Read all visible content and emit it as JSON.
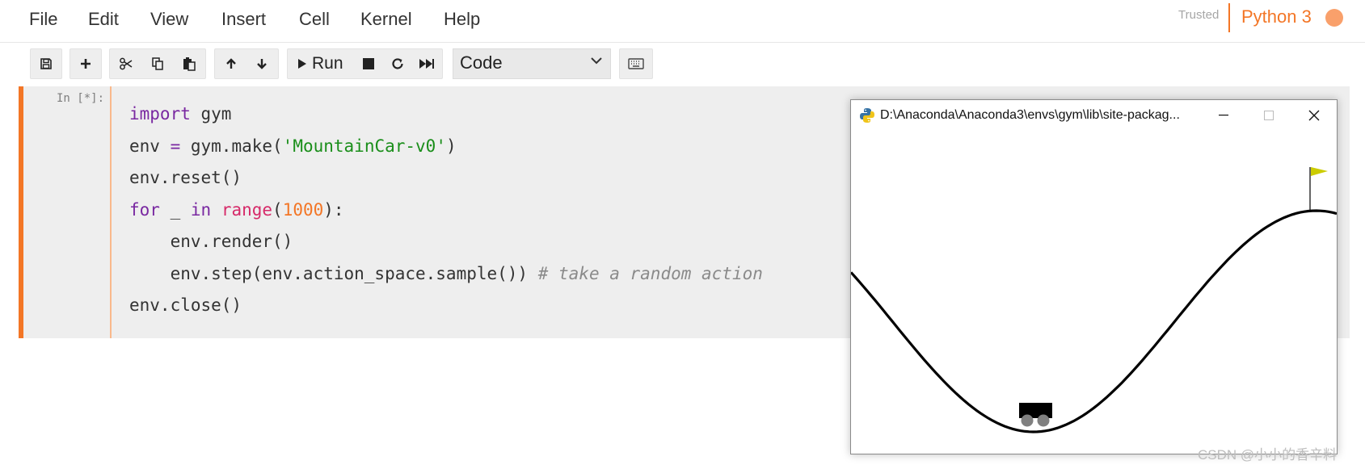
{
  "menu": {
    "items": [
      "File",
      "Edit",
      "View",
      "Insert",
      "Cell",
      "Kernel",
      "Help"
    ]
  },
  "kernel": {
    "trusted_label": "Trusted",
    "name": "Python 3",
    "status_color": "#f9a06b",
    "accent_color": "#f37626"
  },
  "toolbar": {
    "save_icon": "save-icon",
    "run_label": "Run",
    "cell_type": "Code"
  },
  "cell": {
    "prompt": "In [*]:",
    "code": {
      "line1": {
        "kw": "import",
        "rest": " gym"
      },
      "line2": {
        "a": "env ",
        "op": "=",
        "b": " gym.make(",
        "str": "'MountainCar-v0'",
        "c": ")"
      },
      "line3": "env.reset()",
      "line4": {
        "kw1": "for",
        "a": " _ ",
        "kw2": "in",
        "sp": " ",
        "bi": "range",
        "b": "(",
        "num": "1000",
        "c": "):"
      },
      "line5": "    env.render()",
      "line6": {
        "a": "    env.step(env.action_space.sample()) ",
        "cmt": "# take a random action"
      },
      "line7": "env.close()"
    }
  },
  "render_window": {
    "title": "D:\\Anaconda\\Anaconda3\\envs\\gym\\lib\\site-packag...",
    "flag_color": "#cccc00",
    "car_color": "#000000",
    "wheel_color": "#808080"
  },
  "watermark": "CSDN @小小的香辛料"
}
